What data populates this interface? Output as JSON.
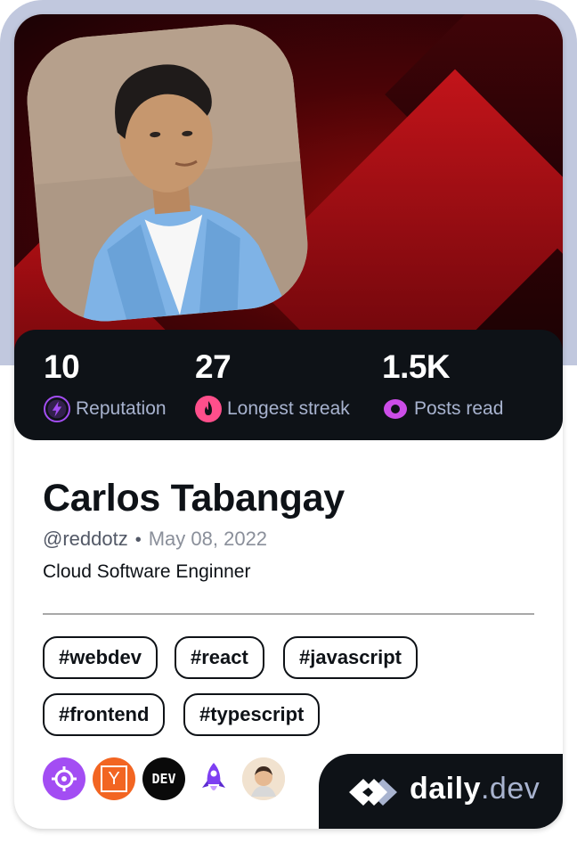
{
  "profile": {
    "name": "Carlos Tabangay",
    "handle": "@reddotz",
    "separator": "•",
    "joined": "May 08, 2022",
    "bio": "Cloud Software Enginner"
  },
  "stats": [
    {
      "value": "10",
      "label": "Reputation",
      "icon": "lightning-icon",
      "color": "#a34df3"
    },
    {
      "value": "27",
      "label": "Longest streak",
      "icon": "flame-icon",
      "color": "#ff4f8b"
    },
    {
      "value": "1.5K",
      "label": "Posts read",
      "icon": "eye-icon",
      "color": "#cc4de8"
    }
  ],
  "tags": [
    "#webdev",
    "#react",
    "#javascript",
    "#frontend",
    "#typescript"
  ],
  "badges": [
    {
      "icon": "crosshair-icon",
      "color": "#a34df3"
    },
    {
      "icon": "ycombinator-icon",
      "color": "#f26522",
      "glyph": "Y"
    },
    {
      "icon": "dev-icon",
      "color": "#0a0a0a",
      "glyph": "DEV"
    },
    {
      "icon": "rocket-icon",
      "color": "#7e3ff2"
    },
    {
      "icon": "avatar-squad-icon",
      "color": "#f1e2cf"
    }
  ],
  "brand": {
    "name": "daily",
    "suffix": ".dev"
  },
  "colors": {
    "cover": "#8a0a0a",
    "frame": "#c1c8de",
    "dark": "#0e1217",
    "muted": "#a8b3cf"
  }
}
